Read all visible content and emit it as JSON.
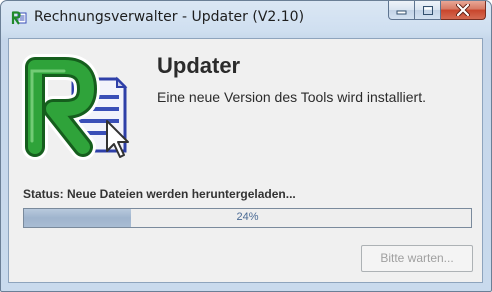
{
  "window": {
    "title": "Rechnungsverwalter - Updater (V2.10)"
  },
  "content": {
    "heading": "Updater",
    "subheading": "Eine neue Version des Tools wird installiert.",
    "status": "Status:  Neue Dateien werden heruntergeladen...",
    "progress_text": "24%",
    "progress_value": 0.24
  },
  "buttons": {
    "wait_label": "Bitte warten..."
  },
  "icons": {
    "app": "rechnungsverwalter-logo-icon",
    "minimize": "minimize-icon",
    "maximize": "maximize-icon",
    "close": "close-icon"
  },
  "colors": {
    "progress_fill": "#9fb4cd",
    "close_button": "#c8452c",
    "logo_green": "#1f8a2a",
    "logo_blue": "#3a4fb8"
  }
}
